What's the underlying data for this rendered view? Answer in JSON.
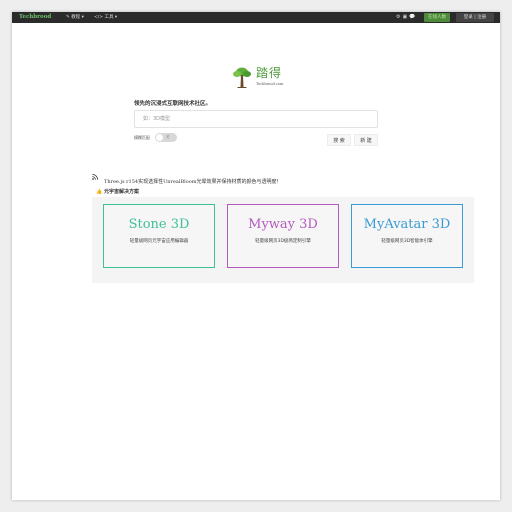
{
  "header": {
    "brand": "Techbrood",
    "nav": [
      {
        "label": "✎ 教程 ▾"
      },
      {
        "label": "</> 工具 ▾"
      }
    ],
    "icons": [
      "settings-icon",
      "weibo-icon",
      "wechat-icon"
    ],
    "online": "在线人数",
    "auth": "登录 | 注册"
  },
  "logo": {
    "cn": "踏得",
    "en": "Techbrood.com"
  },
  "search": {
    "slogan": "领先的沉浸式互联网技术社区。",
    "placeholder": "如：3D模型",
    "fuzzy_label": "模糊匹配",
    "toggle_state": "关",
    "search_button": "搜 索",
    "new_button": "新 建"
  },
  "news": {
    "headline": "Three.js r154实现选择性UnrealBloom光晕效果并保持材质的颜色与透明度！"
  },
  "solutions": {
    "heading": "元宇宙解决方案",
    "cards": [
      {
        "title": "Stone 3D",
        "desc": "轻量级网页元宇宙应用编辑器",
        "color": "#3fbf9a"
      },
      {
        "title": "Myway 3D",
        "desc": "轻量级网页3D极简定制引擎",
        "color": "#b35bbf"
      },
      {
        "title": "MyAvatar 3D",
        "desc": "轻量级网页3D智能体引擎",
        "color": "#3a9ad4"
      }
    ]
  }
}
